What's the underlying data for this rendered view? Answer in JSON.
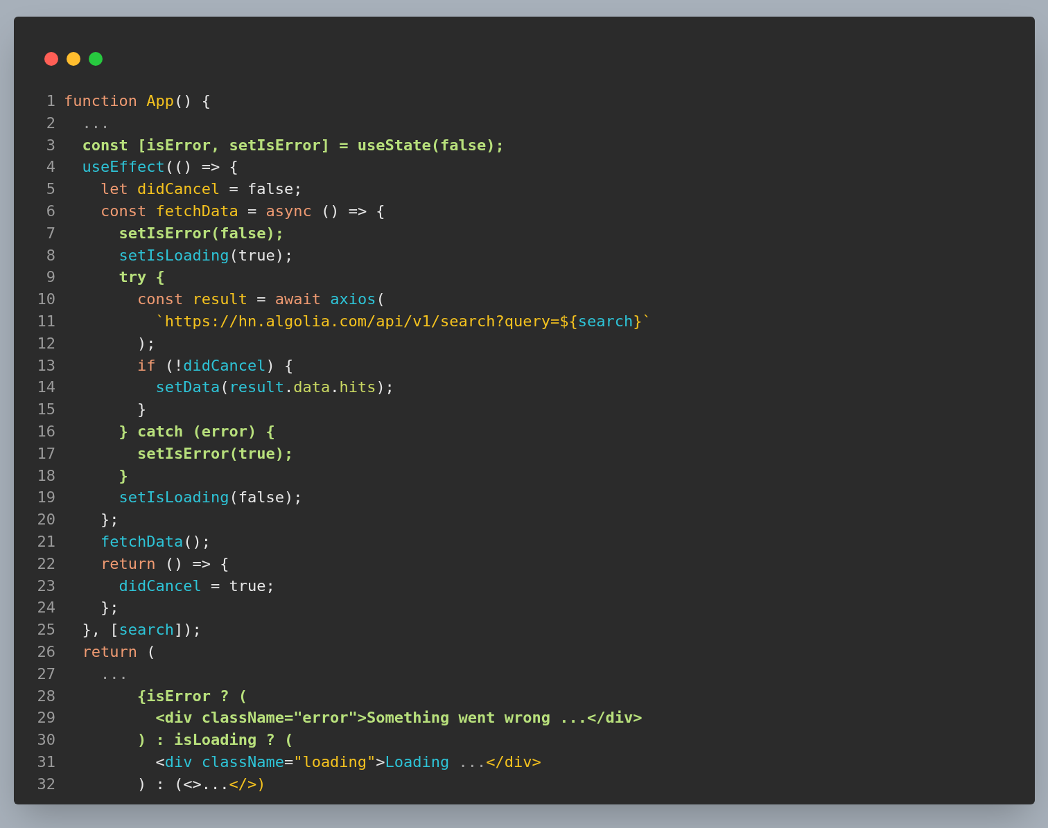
{
  "window": {
    "controls": [
      {
        "kind": "close"
      },
      {
        "kind": "minimize"
      },
      {
        "kind": "zoom"
      }
    ]
  },
  "code": {
    "lines": [
      {
        "number": "1",
        "tokens": [
          {
            "text": "function ",
            "kind": "kw"
          },
          {
            "text": "App",
            "kind": "id"
          },
          {
            "text": "() {",
            "kind": "pl"
          }
        ]
      },
      {
        "number": "2",
        "tokens": [
          {
            "text": "  ...",
            "kind": "dim"
          }
        ]
      },
      {
        "number": "3",
        "tokens": [
          {
            "text": "  const [isError, setIsError] = useState(false);",
            "kind": "hl"
          }
        ]
      },
      {
        "number": "4",
        "tokens": [
          {
            "text": "  useEffect",
            "kind": "fn"
          },
          {
            "text": "(() => {",
            "kind": "pl"
          }
        ]
      },
      {
        "number": "5",
        "tokens": [
          {
            "text": "    let ",
            "kind": "kw"
          },
          {
            "text": "didCancel",
            "kind": "id"
          },
          {
            "text": " = false;",
            "kind": "pl"
          }
        ]
      },
      {
        "number": "6",
        "tokens": [
          {
            "text": "    const ",
            "kind": "kw"
          },
          {
            "text": "fetchData",
            "kind": "id"
          },
          {
            "text": " = ",
            "kind": "pl"
          },
          {
            "text": "async",
            "kind": "kw"
          },
          {
            "text": " () => {",
            "kind": "pl"
          }
        ]
      },
      {
        "number": "7",
        "tokens": [
          {
            "text": "      setIsError(false);",
            "kind": "hl"
          }
        ]
      },
      {
        "number": "8",
        "tokens": [
          {
            "text": "      setIsLoading",
            "kind": "fn"
          },
          {
            "text": "(true);",
            "kind": "pl"
          }
        ]
      },
      {
        "number": "9",
        "tokens": [
          {
            "text": "      try {",
            "kind": "hl"
          }
        ]
      },
      {
        "number": "10",
        "tokens": [
          {
            "text": "        const ",
            "kind": "kw"
          },
          {
            "text": "result",
            "kind": "id"
          },
          {
            "text": " = ",
            "kind": "pl"
          },
          {
            "text": "await ",
            "kind": "kw"
          },
          {
            "text": "axios",
            "kind": "fn"
          },
          {
            "text": "(",
            "kind": "pl"
          }
        ]
      },
      {
        "number": "11",
        "tokens": [
          {
            "text": "          `https://hn.algolia.com/api/v1/search?query=${",
            "kind": "id"
          },
          {
            "text": "search",
            "kind": "fn"
          },
          {
            "text": "}`",
            "kind": "id"
          }
        ]
      },
      {
        "number": "12",
        "tokens": [
          {
            "text": "        );",
            "kind": "pl"
          }
        ]
      },
      {
        "number": "13",
        "tokens": [
          {
            "text": "        if ",
            "kind": "kw"
          },
          {
            "text": "(!",
            "kind": "pl"
          },
          {
            "text": "didCancel",
            "kind": "fn"
          },
          {
            "text": ") {",
            "kind": "pl"
          }
        ]
      },
      {
        "number": "14",
        "tokens": [
          {
            "text": "          setData",
            "kind": "fn"
          },
          {
            "text": "(",
            "kind": "pl"
          },
          {
            "text": "result",
            "kind": "fn"
          },
          {
            "text": ".",
            "kind": "pl"
          },
          {
            "text": "data",
            "kind": "prop"
          },
          {
            "text": ".",
            "kind": "pl"
          },
          {
            "text": "hits",
            "kind": "prop"
          },
          {
            "text": ");",
            "kind": "pl"
          }
        ]
      },
      {
        "number": "15",
        "tokens": [
          {
            "text": "        }",
            "kind": "pl"
          }
        ]
      },
      {
        "number": "16",
        "tokens": [
          {
            "text": "      } catch (error) {",
            "kind": "hl"
          }
        ]
      },
      {
        "number": "17",
        "tokens": [
          {
            "text": "        setIsError(true);",
            "kind": "hl"
          }
        ]
      },
      {
        "number": "18",
        "tokens": [
          {
            "text": "      }",
            "kind": "hl"
          }
        ]
      },
      {
        "number": "19",
        "tokens": [
          {
            "text": "      setIsLoading",
            "kind": "fn"
          },
          {
            "text": "(false);",
            "kind": "pl"
          }
        ]
      },
      {
        "number": "20",
        "tokens": [
          {
            "text": "    };",
            "kind": "pl"
          }
        ]
      },
      {
        "number": "21",
        "tokens": [
          {
            "text": "    fetchData",
            "kind": "fn"
          },
          {
            "text": "();",
            "kind": "pl"
          }
        ]
      },
      {
        "number": "22",
        "tokens": [
          {
            "text": "    return ",
            "kind": "kw"
          },
          {
            "text": "() => {",
            "kind": "pl"
          }
        ]
      },
      {
        "number": "23",
        "tokens": [
          {
            "text": "      didCancel",
            "kind": "fn"
          },
          {
            "text": " = true;",
            "kind": "pl"
          }
        ]
      },
      {
        "number": "24",
        "tokens": [
          {
            "text": "    };",
            "kind": "pl"
          }
        ]
      },
      {
        "number": "25",
        "tokens": [
          {
            "text": "  }, [",
            "kind": "pl"
          },
          {
            "text": "search",
            "kind": "fn"
          },
          {
            "text": "]);",
            "kind": "pl"
          }
        ]
      },
      {
        "number": "26",
        "tokens": [
          {
            "text": "  return ",
            "kind": "kw"
          },
          {
            "text": "(",
            "kind": "pl"
          }
        ]
      },
      {
        "number": "27",
        "tokens": [
          {
            "text": "    ...",
            "kind": "dim"
          }
        ]
      },
      {
        "number": "28",
        "tokens": [
          {
            "text": "        {isError ? (",
            "kind": "hl"
          }
        ]
      },
      {
        "number": "29",
        "tokens": [
          {
            "text": "          <div className=\"error\">Something went wrong ...</div>",
            "kind": "hl"
          }
        ]
      },
      {
        "number": "30",
        "tokens": [
          {
            "text": "        ) : isLoading ? (",
            "kind": "hl"
          }
        ]
      },
      {
        "number": "31",
        "tokens": [
          {
            "text": "          <",
            "kind": "pl"
          },
          {
            "text": "div className",
            "kind": "fn"
          },
          {
            "text": "=",
            "kind": "pl"
          },
          {
            "text": "\"loading\"",
            "kind": "id"
          },
          {
            "text": ">",
            "kind": "pl"
          },
          {
            "text": "Loading",
            "kind": "fn"
          },
          {
            "text": " ...",
            "kind": "dim"
          },
          {
            "text": "</div>",
            "kind": "id"
          }
        ]
      },
      {
        "number": "32",
        "tokens": [
          {
            "text": "        ) : (<>...",
            "kind": "pl"
          },
          {
            "text": "</>)",
            "kind": "id"
          }
        ]
      }
    ]
  }
}
